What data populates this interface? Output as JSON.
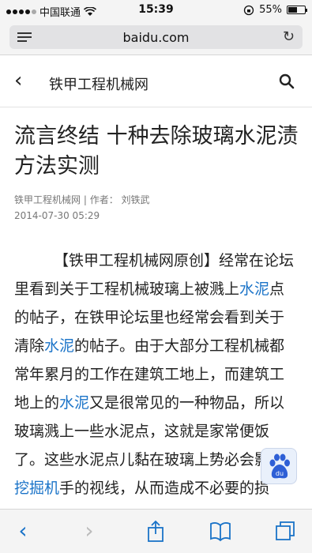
{
  "status": {
    "carrier": "中国联通",
    "time": "15:39",
    "battery": "55%",
    "battery_level": 0.55
  },
  "browser": {
    "url": "baidu.com"
  },
  "site": {
    "name": "铁甲工程机械网"
  },
  "article": {
    "title": "流言终结 十种去除玻璃水泥渍方法实测",
    "source": "铁甲工程机械网",
    "author_label": "作者：",
    "author": "刘铁武",
    "date": "2014-07-30 05:29",
    "p1_a": "【铁甲工程机械网原创】经常在论坛里看到关于工程机械玻璃上被溅上",
    "link1": "水泥",
    "p1_b": "点的帖子，在铁甲论坛里也经常会看到关于清除",
    "link2": "水泥",
    "p1_c": "的帖子。由于大部分工程机械都常年累月的工作在建筑工地上，而建筑工地上的",
    "link3": "水泥",
    "p1_d": "又是很常见的一种物品，所以玻璃溅上一些水泥点，这就是家常便饭了。这些水泥点儿黏在玻璃上势必会影响",
    "link4": "挖掘机",
    "p1_e": "手的视线，从而造成不必要的损"
  },
  "colors": {
    "link": "#1a73c8",
    "toolbar_icon": "#1a73c8"
  },
  "icons": [
    "menu-icon",
    "reload-icon",
    "back-icon",
    "search-icon",
    "baidu-paw-icon",
    "back-arrow-icon",
    "forward-arrow-icon",
    "share-icon",
    "bookmarks-icon",
    "tabs-icon"
  ]
}
